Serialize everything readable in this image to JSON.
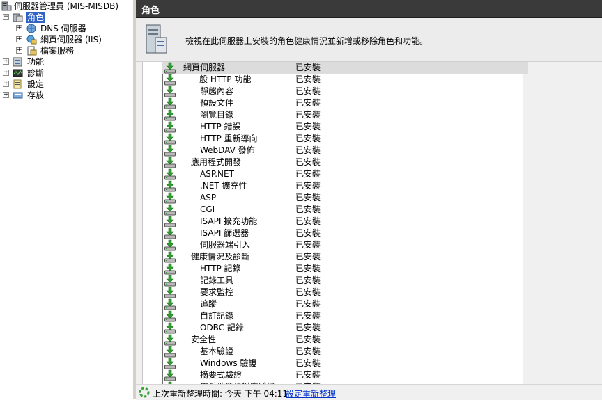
{
  "tree": {
    "root": "伺服器管理員 (MIS-MISDB)",
    "roles": "角色",
    "dns": "DNS 伺服器",
    "iis": "網頁伺服器 (IIS)",
    "file": "檔案服務",
    "features": "功能",
    "diagnostics": "診斷",
    "configuration": "設定",
    "storage": "存放",
    "expand_plus": "+",
    "expand_minus": "−"
  },
  "header": {
    "title": "角色"
  },
  "banner": {
    "text": "檢視在此伺服器上安裝的角色健康情況並新增或移除角色和功能。"
  },
  "role_services": [
    {
      "name": "網頁伺服器",
      "status": "已安裝",
      "level": 0
    },
    {
      "name": "一般 HTTP 功能",
      "status": "已安裝",
      "level": 1
    },
    {
      "name": "靜態內容",
      "status": "已安裝",
      "level": 2
    },
    {
      "name": "預設文件",
      "status": "已安裝",
      "level": 2
    },
    {
      "name": "瀏覽目錄",
      "status": "已安裝",
      "level": 2
    },
    {
      "name": "HTTP 錯誤",
      "status": "已安裝",
      "level": 2
    },
    {
      "name": "HTTP 重新導向",
      "status": "已安裝",
      "level": 2
    },
    {
      "name": "WebDAV 發佈",
      "status": "已安裝",
      "level": 2
    },
    {
      "name": "應用程式開發",
      "status": "已安裝",
      "level": 1
    },
    {
      "name": "ASP.NET",
      "status": "已安裝",
      "level": 2
    },
    {
      "name": ".NET 擴充性",
      "status": "已安裝",
      "level": 2
    },
    {
      "name": "ASP",
      "status": "已安裝",
      "level": 2
    },
    {
      "name": "CGI",
      "status": "已安裝",
      "level": 2
    },
    {
      "name": "ISAPI 擴充功能",
      "status": "已安裝",
      "level": 2
    },
    {
      "name": "ISAPI 篩選器",
      "status": "已安裝",
      "level": 2
    },
    {
      "name": "伺服器端引入",
      "status": "已安裝",
      "level": 2
    },
    {
      "name": "健康情況及診斷",
      "status": "已安裝",
      "level": 1
    },
    {
      "name": "HTTP 記錄",
      "status": "已安裝",
      "level": 2
    },
    {
      "name": "記錄工具",
      "status": "已安裝",
      "level": 2
    },
    {
      "name": "要求監控",
      "status": "已安裝",
      "level": 2
    },
    {
      "name": "追蹤",
      "status": "已安裝",
      "level": 2
    },
    {
      "name": "自訂記錄",
      "status": "已安裝",
      "level": 2
    },
    {
      "name": "ODBC 記錄",
      "status": "已安裝",
      "level": 2
    },
    {
      "name": "安全性",
      "status": "已安裝",
      "level": 1
    },
    {
      "name": "基本驗證",
      "status": "已安裝",
      "level": 2
    },
    {
      "name": "Windows 驗證",
      "status": "已安裝",
      "level": 2
    },
    {
      "name": "摘要式驗證",
      "status": "已安裝",
      "level": 2
    },
    {
      "name": "用戶端憑證對應驗證",
      "status": "已安裝",
      "level": 2
    }
  ],
  "statusbar": {
    "last_refresh": "上次重新整理時間: 今天 下午 04:11",
    "configure_refresh": "設定重新整理"
  },
  "colors": {
    "header_bg": "#3a3a3a",
    "selection": "#3163c5",
    "link": "#0033cc",
    "installed_arrow": "#2e9b2e"
  }
}
